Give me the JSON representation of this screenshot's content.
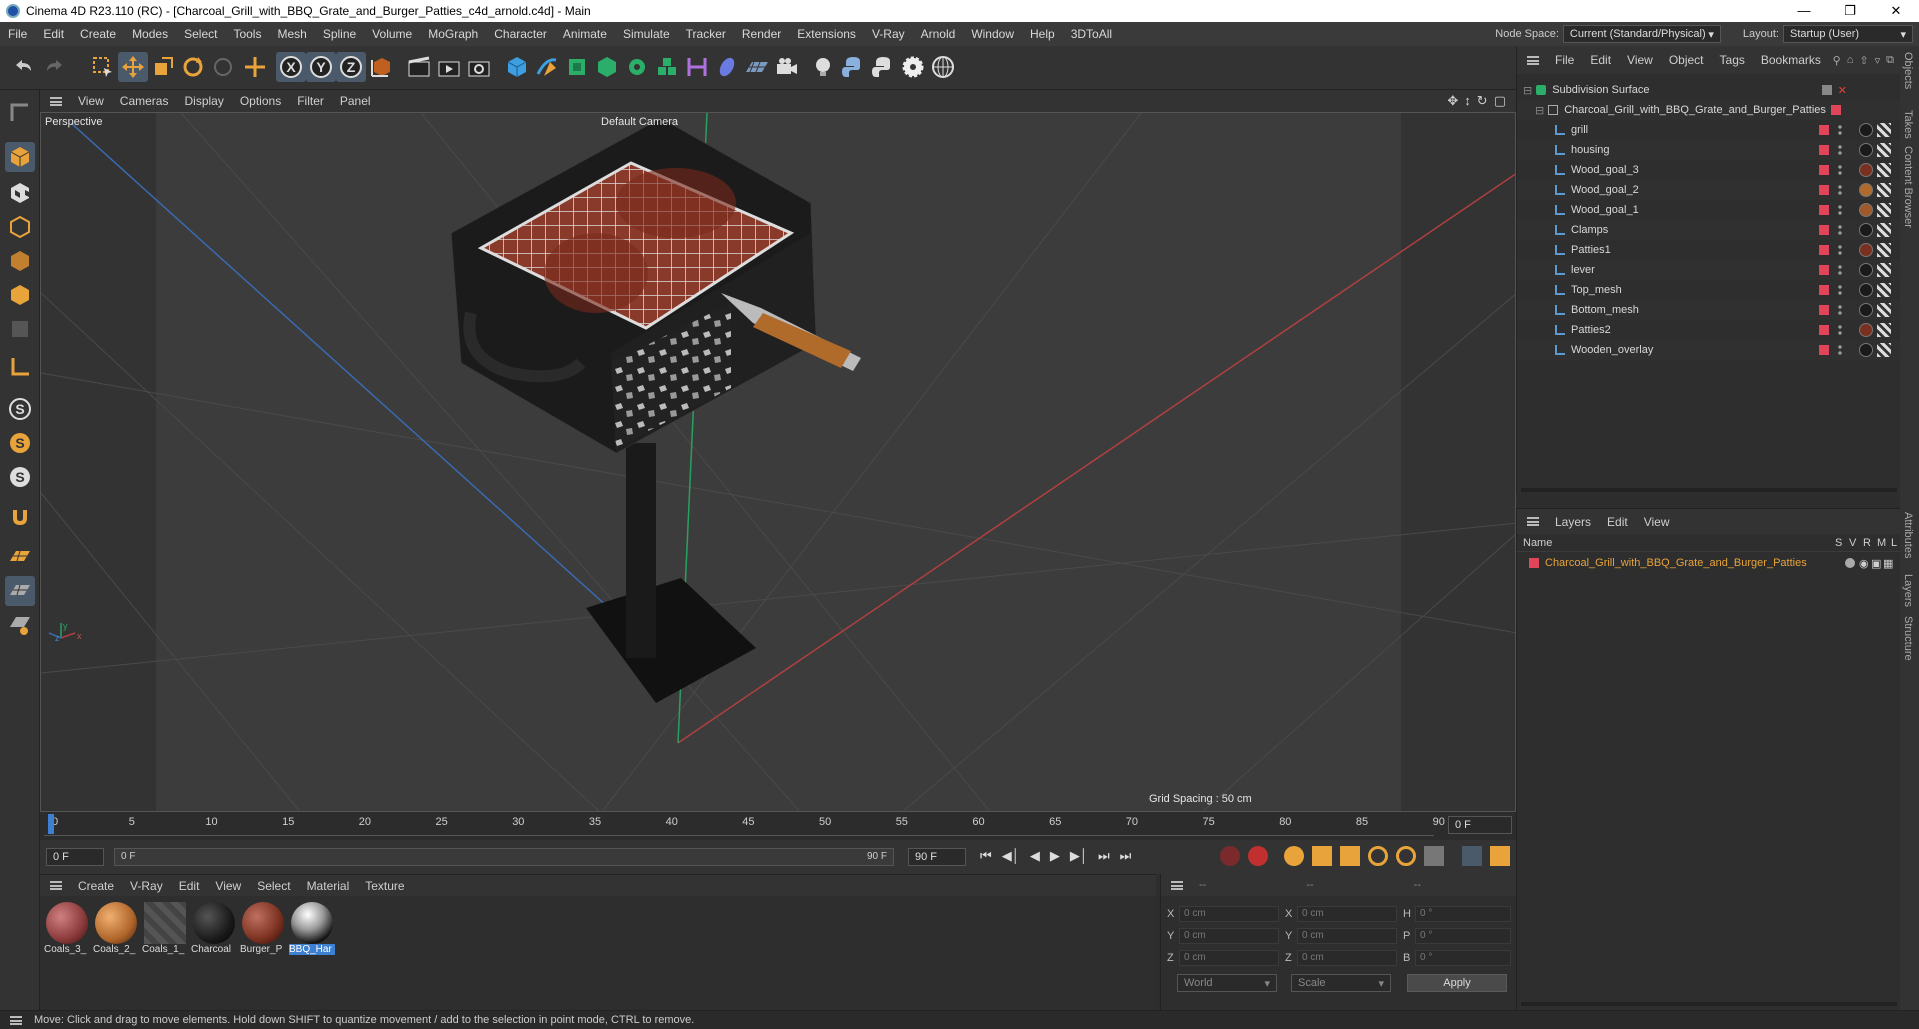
{
  "titlebar": {
    "title": "Cinema 4D R23.110 (RC) - [Charcoal_Grill_with_BBQ_Grate_and_Burger_Patties_c4d_arnold.c4d] - Main"
  },
  "menubar": {
    "items": [
      "File",
      "Edit",
      "Create",
      "Modes",
      "Select",
      "Tools",
      "Mesh",
      "Spline",
      "Volume",
      "MoGraph",
      "Character",
      "Animate",
      "Simulate",
      "Tracker",
      "Render",
      "Extensions",
      "V-Ray",
      "Arnold",
      "Window",
      "Help",
      "3DToAll"
    ],
    "node_space_label": "Node Space:",
    "node_space_value": "Current (Standard/Physical)",
    "layout_label": "Layout:",
    "layout_value": "Startup (User)"
  },
  "viewport": {
    "menu": [
      "View",
      "Cameras",
      "Display",
      "Options",
      "Filter",
      "Panel"
    ],
    "label": "Perspective",
    "camera": "Default Camera",
    "grid_spacing": "Grid Spacing : 50 cm"
  },
  "timeline": {
    "ticks": [
      "0",
      "5",
      "10",
      "15",
      "20",
      "25",
      "30",
      "35",
      "40",
      "45",
      "50",
      "55",
      "60",
      "65",
      "70",
      "75",
      "80",
      "85",
      "90"
    ],
    "current_frame": "0 F",
    "start_frame": "0 F",
    "range_start": "0 F",
    "range_end": "90 F",
    "end_frame": "90 F"
  },
  "materials": {
    "menu": [
      "Create",
      "V-Ray",
      "Edit",
      "View",
      "Select",
      "Material",
      "Texture"
    ],
    "items": [
      {
        "name": "Coals_3_",
        "color": "#8a3a3a"
      },
      {
        "name": "Coals_2_",
        "color": "#b0652a"
      },
      {
        "name": "Coals_1_",
        "color": "#555555"
      },
      {
        "name": "Charcoal",
        "color": "#1a1a1a"
      },
      {
        "name": "Burger_P",
        "color": "#7a3020"
      },
      {
        "name": "BBQ_Har",
        "color": "#dddddd"
      }
    ]
  },
  "coords": {
    "header": [
      "--",
      "--",
      "--"
    ],
    "rows": [
      {
        "l1": "X",
        "v1": "0 cm",
        "l2": "X",
        "v2": "0 cm",
        "l3": "H",
        "v3": "0 °"
      },
      {
        "l1": "Y",
        "v1": "0 cm",
        "l2": "Y",
        "v2": "0 cm",
        "l3": "P",
        "v3": "0 °"
      },
      {
        "l1": "Z",
        "v1": "0 cm",
        "l2": "Z",
        "v2": "0 cm",
        "l3": "B",
        "v3": "0 °"
      }
    ],
    "world": "World",
    "scale": "Scale",
    "apply": "Apply"
  },
  "objects": {
    "menu": [
      "File",
      "Edit",
      "View",
      "Object",
      "Tags",
      "Bookmarks"
    ],
    "root": "Subdivision Surface",
    "group": "Charcoal_Grill_with_BBQ_Grate_and_Burger_Patties",
    "children": [
      "grill",
      "housing",
      "Wood_goal_3",
      "Wood_goal_2",
      "Wood_goal_1",
      "Clamps",
      "Patties1",
      "lever",
      "Top_mesh",
      "Bottom_mesh",
      "Patties2",
      "Wooden_overlay"
    ]
  },
  "layers": {
    "menu": [
      "Layers",
      "Edit",
      "View"
    ],
    "columns": {
      "name": "Name",
      "s": "S",
      "v": "V",
      "r": "R",
      "m": "M",
      "l": "L"
    },
    "items": [
      "Charcoal_Grill_with_BBQ_Grate_and_Burger_Patties"
    ],
    "color": "#e0455a"
  },
  "side_tabs": [
    "Objects",
    "Takes",
    "Content Browser",
    "Attributes",
    "Layers",
    "Structure"
  ],
  "status": "Move: Click and drag to move elements. Hold down SHIFT to quantize movement / add to the selection in point mode, CTRL to remove.",
  "colors": {
    "accent": "#e8a33a",
    "selection": "#3d7fd0",
    "layer_color": "#e0455a"
  }
}
